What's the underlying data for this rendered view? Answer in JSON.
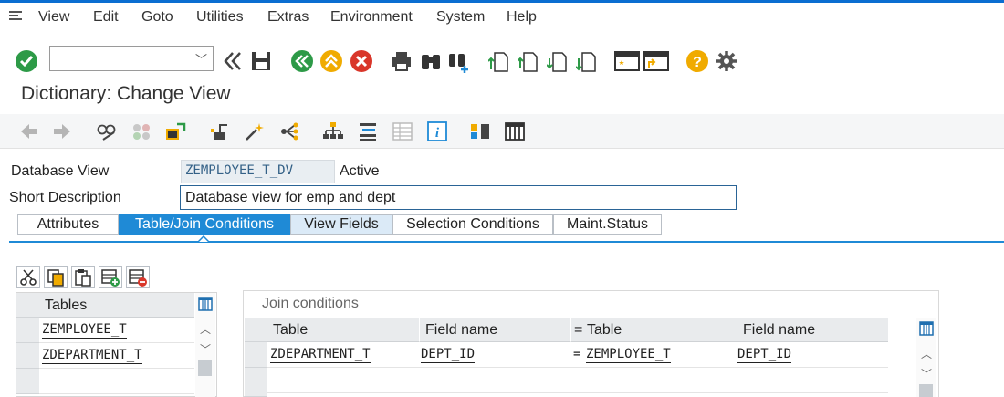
{
  "menu": {
    "items": [
      "View",
      "Edit",
      "Goto",
      "Utilities",
      "Extras",
      "Environment",
      "System",
      "Help"
    ]
  },
  "toolbar": {
    "command_field_value": "",
    "icons": [
      "enter-icon",
      "back-icon",
      "save-icon",
      "back-icon",
      "exit-icon",
      "cancel-icon",
      "print-icon",
      "find-icon",
      "find-next-icon",
      "first-page-icon",
      "previous-page-icon",
      "next-page-icon",
      "last-page-icon",
      "create-session-icon",
      "shortcut-icon",
      "help-icon",
      "settings-icon"
    ]
  },
  "page": {
    "title": "Dictionary: Change View"
  },
  "fields": {
    "database_view_label": "Database View",
    "database_view_value": "ZEMPLOYEE_T_DV",
    "status": "Active",
    "short_description_label": "Short Description",
    "short_description_value": "Database view for emp and dept"
  },
  "tabs": [
    {
      "label": "Attributes"
    },
    {
      "label": "Table/Join Conditions"
    },
    {
      "label": "View Fields"
    },
    {
      "label": "Selection Conditions"
    },
    {
      "label": "Maint.Status"
    }
  ],
  "tables_grid": {
    "header": "Tables",
    "rows": [
      "ZEMPLOYEE_T",
      "ZDEPARTMENT_T",
      "",
      ""
    ]
  },
  "join_conditions": {
    "title": "Join conditions",
    "headers": [
      "Table",
      "Field name",
      "=",
      "Table",
      "Field name"
    ],
    "rows": [
      {
        "table1": "ZDEPARTMENT_T",
        "field1": "DEPT_ID",
        "eq": "=",
        "table2": "ZEMPLOYEE_T",
        "field2": "DEPT_ID"
      }
    ]
  },
  "colors": {
    "accent": "#1f8ad6",
    "top_bar": "#0a6ed1",
    "confirm_green": "#2d9a47",
    "cancel_red": "#d9362a",
    "help_orange": "#f0ab00"
  }
}
